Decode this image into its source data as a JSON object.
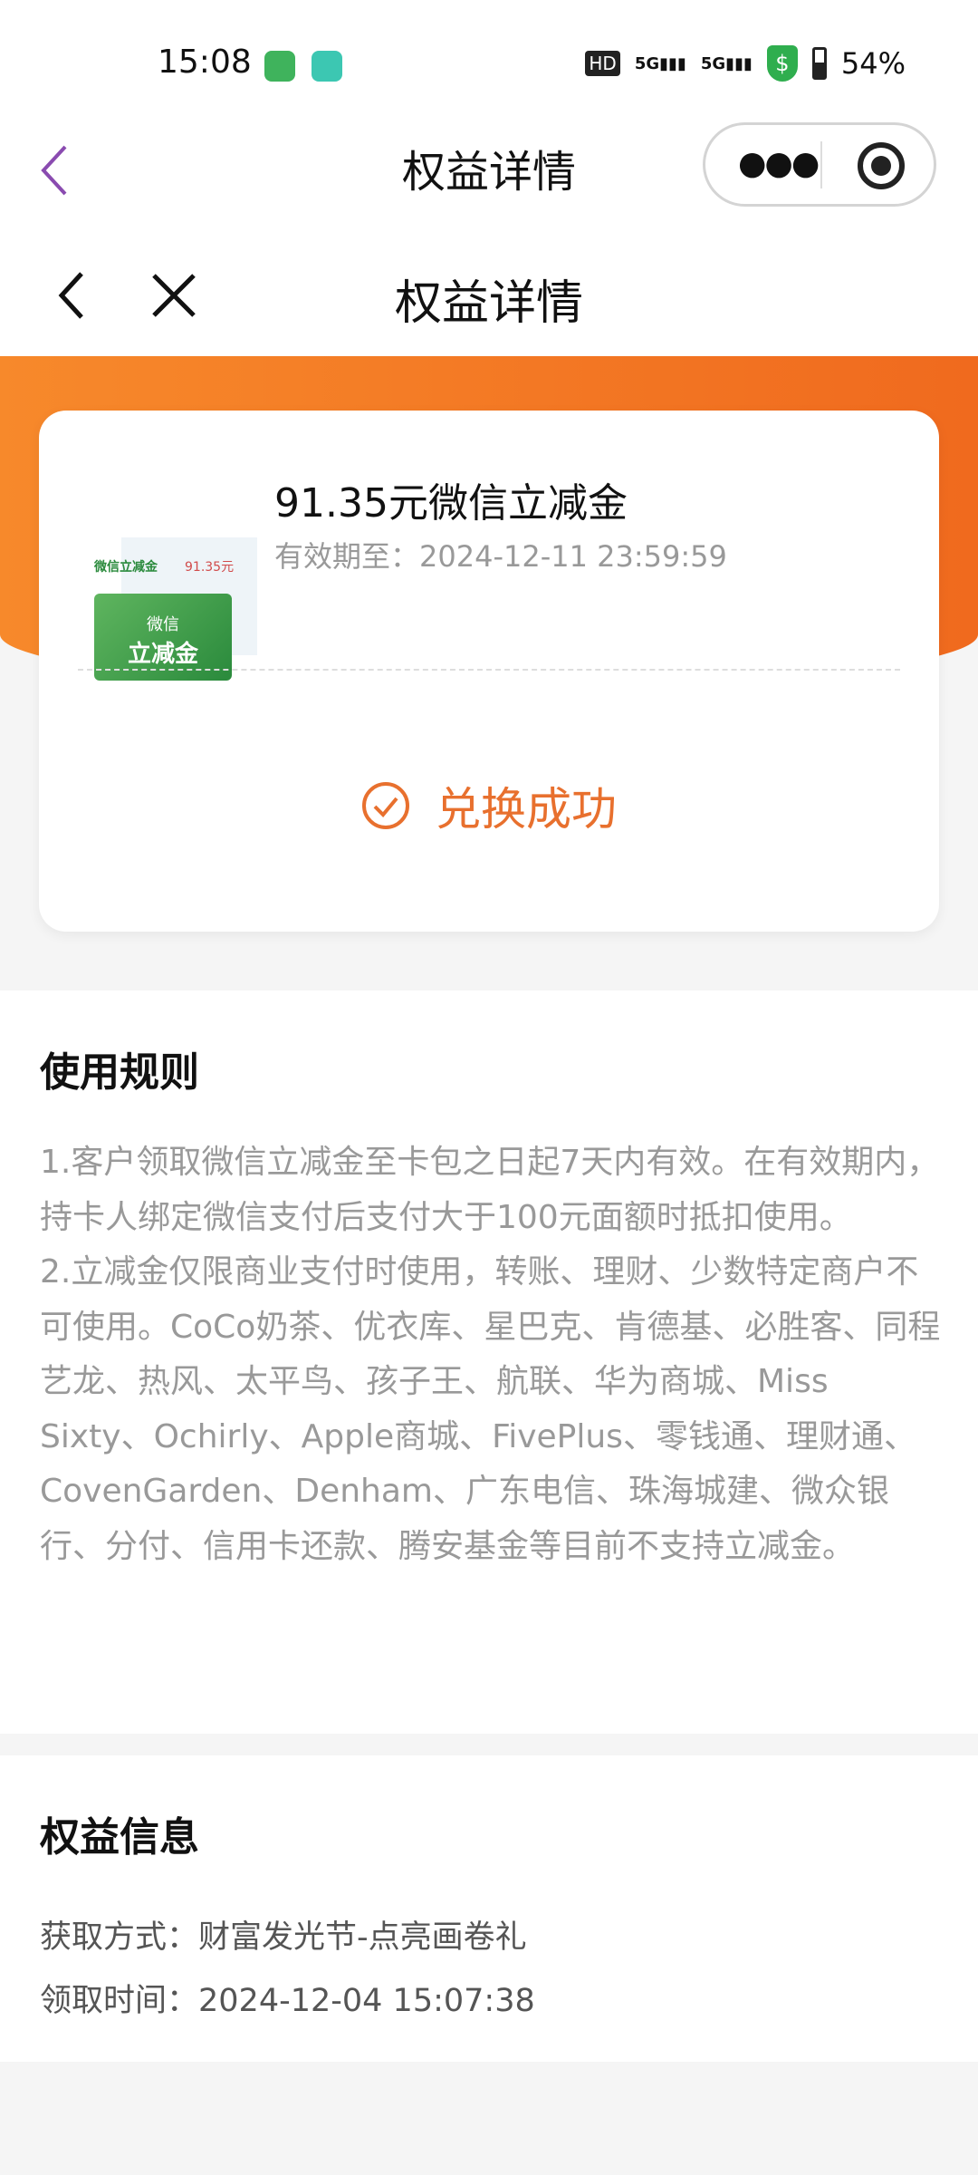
{
  "status_bar": {
    "time": "15:08",
    "battery": "54%",
    "network": "5G"
  },
  "nav": {
    "title": "权益详情",
    "page_title": "权益详情"
  },
  "colors": {
    "accent": "#f06a1e",
    "success": "#e8702e",
    "muted": "#999999"
  },
  "benefit": {
    "thumb_label": "微信立减金",
    "thumb_amount": "91.35元",
    "thumb_card_line1": "微信",
    "thumb_card_line2": "立减金",
    "name": "91.35元微信立减金",
    "expiry_label": "有效期至：",
    "expiry": "2024-12-11 23:59:59",
    "status": "兑换成功"
  },
  "rules": {
    "title": "使用规则",
    "text": "1.客户领取微信立减金至卡包之日起7天内有效。在有效期内，持卡人绑定微信支付后支付大于100元面额时抵扣使用。\n2.立减金仅限商业支付时使用，转账、理财、少数特定商户不可使用。CoCo奶茶、优衣库、星巴克、肯德基、必胜客、同程艺龙、热风、太平鸟、孩子王、航联、华为商城、Miss Sixty、Ochirly、Apple商城、FivePlus、零钱通、理财通、CovenGarden、Denham、广东电信、珠海城建、微众银行、分付、信用卡还款、腾安基金等目前不支持立减金。"
  },
  "info": {
    "title": "权益信息",
    "method_label": "获取方式：",
    "method": "财富发光节-点亮画卷礼",
    "time_label": "领取时间：",
    "time": "2024-12-04 15:07:38"
  }
}
